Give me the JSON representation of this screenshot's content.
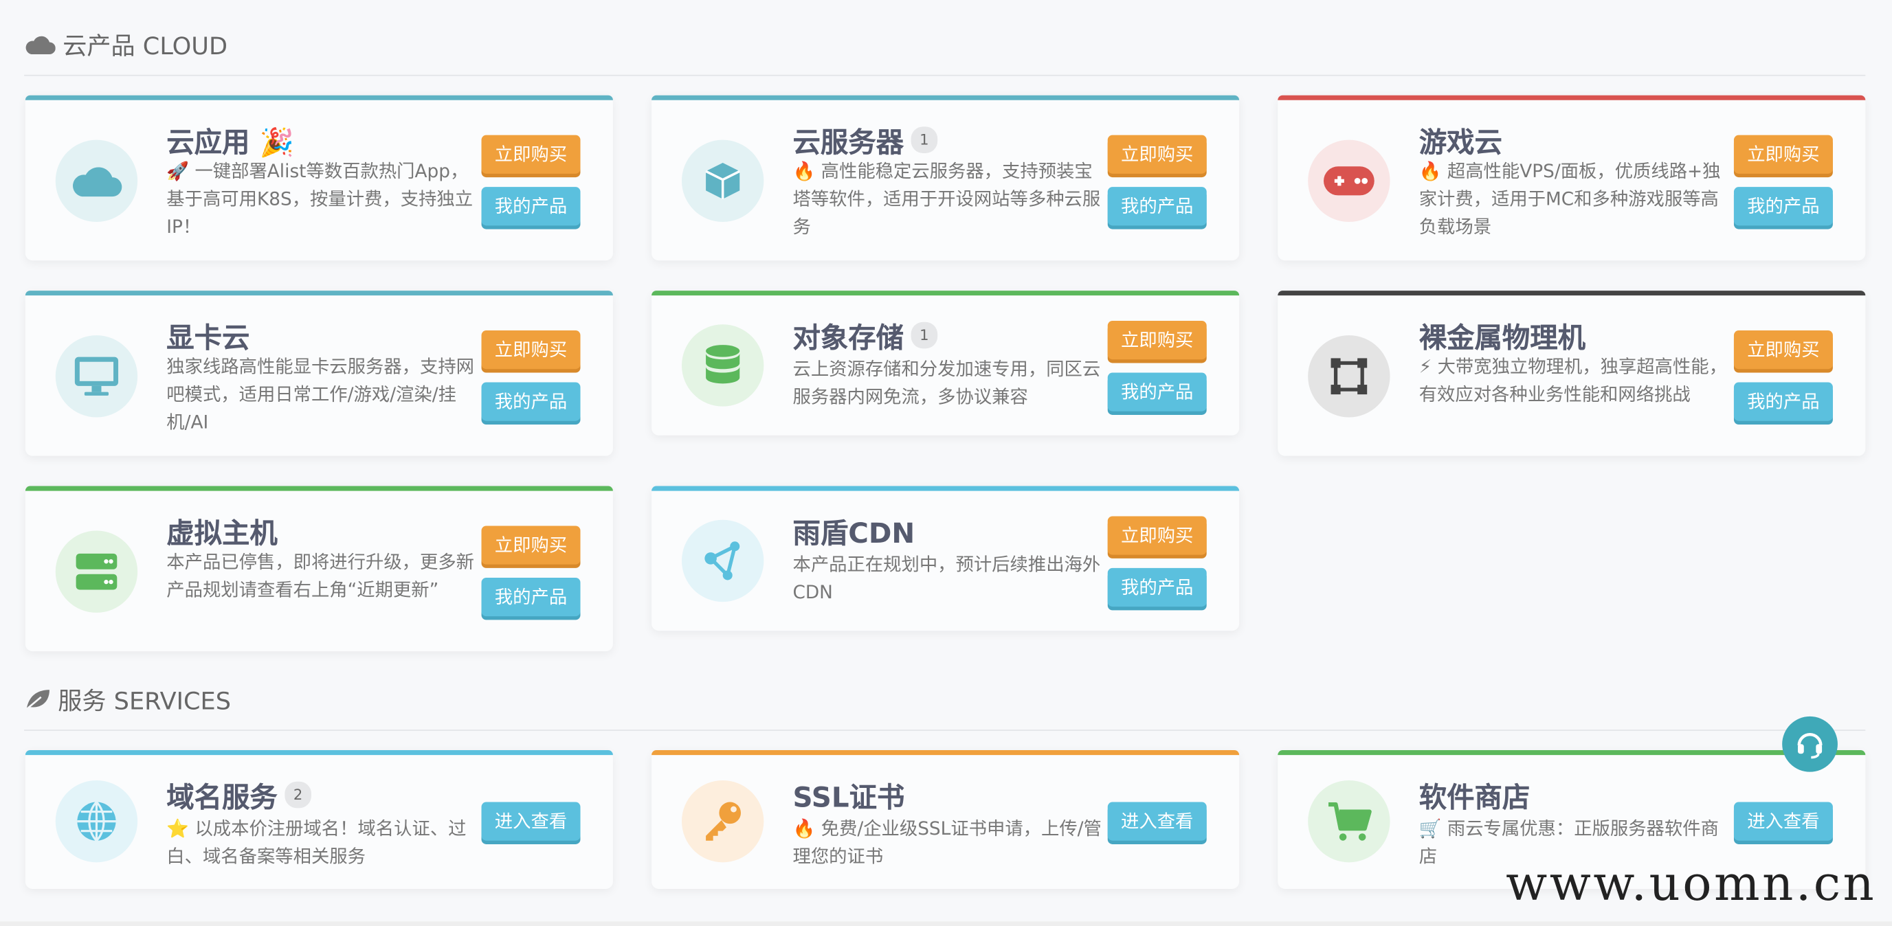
{
  "cloud_section": {
    "title": "云产品 CLOUD"
  },
  "services_section": {
    "title": "服务 SERVICES"
  },
  "buttons": {
    "buy": "立即购买",
    "mine": "我的产品",
    "view": "进入查看"
  },
  "cards": [
    {
      "title": "云应用 🎉",
      "badge": "",
      "desc": "🚀 一键部署Alist等数百款热门App，基于高可用K8S，按量计费，支持独立IP！",
      "accent": "#5fb3c4"
    },
    {
      "title": "云服务器",
      "badge": "1",
      "desc": "🔥 高性能稳定云服务器，支持预装宝塔等软件，适用于开设网站等多种云服务",
      "accent": "#5fb3c4"
    },
    {
      "title": "游戏云",
      "badge": "",
      "desc": "🔥 超高性能VPS/面板，优质线路+独家计费，适用于MC和多种游戏服等高负载场景",
      "accent": "#d9534f"
    },
    {
      "title": "显卡云",
      "badge": "",
      "desc": "独家线路高性能显卡云服务器，支持网吧模式，适用日常工作/游戏/渲染/挂机/AI",
      "accent": "#5fb3c4"
    },
    {
      "title": "对象存储",
      "badge": "1",
      "desc": "云上资源存储和分发加速专用，同区云服务器内网免流，多协议兼容",
      "accent": "#5cb85c"
    },
    {
      "title": "裸金属物理机",
      "badge": "",
      "desc": "⚡ 大带宽独立物理机，独享超高性能，有效应对各种业务性能和网络挑战",
      "accent": "#444444"
    },
    {
      "title": "虚拟主机",
      "badge": "",
      "desc": "本产品已停售，即将进行升级，更多新产品规划请查看右上角“近期更新”",
      "accent": "#5cb85c"
    },
    {
      "title": "雨盾CDN",
      "badge": "",
      "desc": "本产品正在规划中，预计后续推出海外CDN",
      "accent": "#5bc0de"
    }
  ],
  "services": [
    {
      "title": "域名服务",
      "badge": "2",
      "desc": "⭐ 以成本价注册域名！域名认证、过白、域名备案等相关服务",
      "accent": "#5bc0de"
    },
    {
      "title": "SSL证书",
      "badge": "",
      "desc": "🔥 免费/企业级SSL证书申请，上传/管理您的证书",
      "accent": "#f0a03c"
    },
    {
      "title": "软件商店",
      "badge": "",
      "desc": "🛒 雨云专属优惠：正版服务器软件商店",
      "accent": "#5cb85c"
    }
  ],
  "watermark": "www.uomn.cn",
  "icons": [
    "cloud-icon",
    "cube-icon",
    "gamepad-icon",
    "monitor-icon",
    "database-icon",
    "chip-icon",
    "server-icon",
    "share-icon",
    "globe-icon",
    "key-icon",
    "cart-icon",
    "headset-icon",
    "leaf-icon"
  ]
}
